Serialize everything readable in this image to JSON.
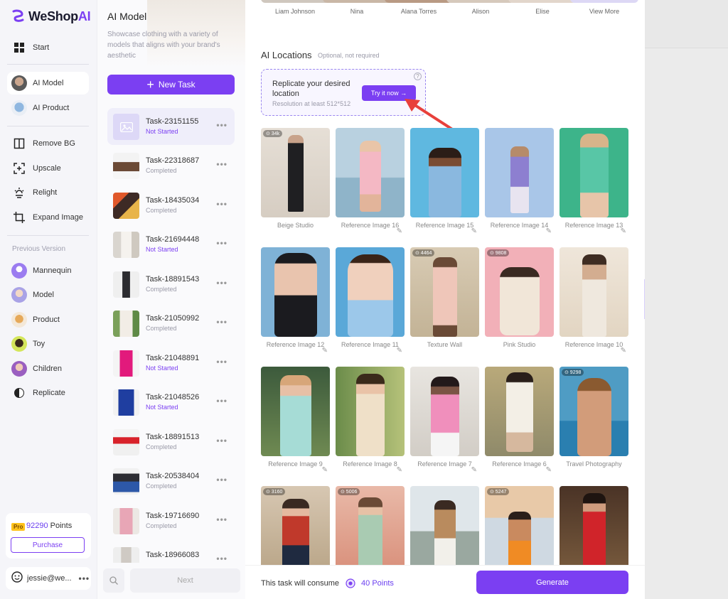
{
  "app": {
    "logo_prefix": "WeShop",
    "logo_suffix": "AI"
  },
  "nav": {
    "items": [
      {
        "label": "Start",
        "icon": "grid-icon"
      },
      {
        "label": "AI Model",
        "icon": "model-avatar-icon",
        "active": true
      },
      {
        "label": "AI Product",
        "icon": "product-avatar-icon"
      },
      {
        "label": "Remove BG",
        "icon": "remove-bg-icon"
      },
      {
        "label": "Upscale",
        "icon": "upscale-icon"
      },
      {
        "label": "Relight",
        "icon": "bulb-icon"
      },
      {
        "label": "Expand Image",
        "icon": "expand-icon"
      }
    ],
    "previous_caption": "Previous Version",
    "previous_items": [
      {
        "label": "Mannequin"
      },
      {
        "label": "Model"
      },
      {
        "label": "Product"
      },
      {
        "label": "Toy"
      },
      {
        "label": "Children"
      },
      {
        "label": "Replicate"
      }
    ],
    "pro_badge": "Pro",
    "points_value": "92290",
    "points_label": "Points",
    "purchase_label": "Purchase",
    "user_name": "jessie@we...",
    "user_more": "•••"
  },
  "task_panel": {
    "title": "AI Model",
    "description": "Showcase clothing with a variety of models that aligns with your brand's aesthetic",
    "new_task_label": "New Task",
    "tasks": [
      {
        "name": "Task-23151155",
        "status": "Not Started"
      },
      {
        "name": "Task-22318687",
        "status": "Completed"
      },
      {
        "name": "Task-18435034",
        "status": "Completed"
      },
      {
        "name": "Task-21694448",
        "status": "Not Started"
      },
      {
        "name": "Task-18891543",
        "status": "Completed"
      },
      {
        "name": "Task-21050992",
        "status": "Completed"
      },
      {
        "name": "Task-21048891",
        "status": "Not Started"
      },
      {
        "name": "Task-21048526",
        "status": "Not Started"
      },
      {
        "name": "Task-18891513",
        "status": "Completed"
      },
      {
        "name": "Task-20538404",
        "status": "Completed"
      },
      {
        "name": "Task-19716690",
        "status": "Completed"
      },
      {
        "name": "Task-18966083",
        "status": ""
      }
    ],
    "more_glyph": "•••",
    "next_label": "Next"
  },
  "main": {
    "models": [
      "Liam Johnson",
      "Nina",
      "Alana Torres",
      "Alison",
      "Elise",
      "View More"
    ],
    "locations_title": "AI Locations",
    "locations_sub": "Optional, not required",
    "replicate_title": "Replicate your desired location",
    "replicate_sub": "Resolution at least 512*512",
    "try_label": "Try it now →",
    "help_glyph": "?",
    "locations": [
      {
        "label": "Beige Studio",
        "count": "34k",
        "edit": false
      },
      {
        "label": "Reference Image 16",
        "count": "",
        "edit": true
      },
      {
        "label": "Reference Image 15",
        "count": "",
        "edit": true
      },
      {
        "label": "Reference Image 14",
        "count": "",
        "edit": true
      },
      {
        "label": "Reference Image 13",
        "count": "",
        "edit": true
      },
      {
        "label": "Reference Image 12",
        "count": "",
        "edit": true
      },
      {
        "label": "Reference Image 11",
        "count": "",
        "edit": true
      },
      {
        "label": "Texture Wall",
        "count": "4464",
        "edit": false
      },
      {
        "label": "Pink Studio",
        "count": "9808",
        "edit": false
      },
      {
        "label": "Reference Image 10",
        "count": "",
        "edit": true
      },
      {
        "label": "Reference Image 9",
        "count": "",
        "edit": true
      },
      {
        "label": "Reference Image 8",
        "count": "",
        "edit": true
      },
      {
        "label": "Reference Image 7",
        "count": "",
        "edit": true
      },
      {
        "label": "Reference Image 6",
        "count": "",
        "edit": true
      },
      {
        "label": "Travel Photography",
        "count": "9298",
        "edit": false
      },
      {
        "label": "",
        "count": "3160",
        "edit": false
      },
      {
        "label": "",
        "count": "5006",
        "edit": false
      },
      {
        "label": "",
        "count": "",
        "edit": false
      },
      {
        "label": "",
        "count": "5247",
        "edit": false
      },
      {
        "label": "",
        "count": "",
        "edit": false
      }
    ],
    "consume_text": "This task will consume",
    "consume_points": "40 Points",
    "generate_label": "Generate"
  },
  "colors": {
    "accent": "#7b3ff2",
    "accent_light": "#f1edff",
    "status_pending": "#7b3ff2",
    "status_done": "#9a9aa8",
    "arrow": "#e8403b"
  }
}
